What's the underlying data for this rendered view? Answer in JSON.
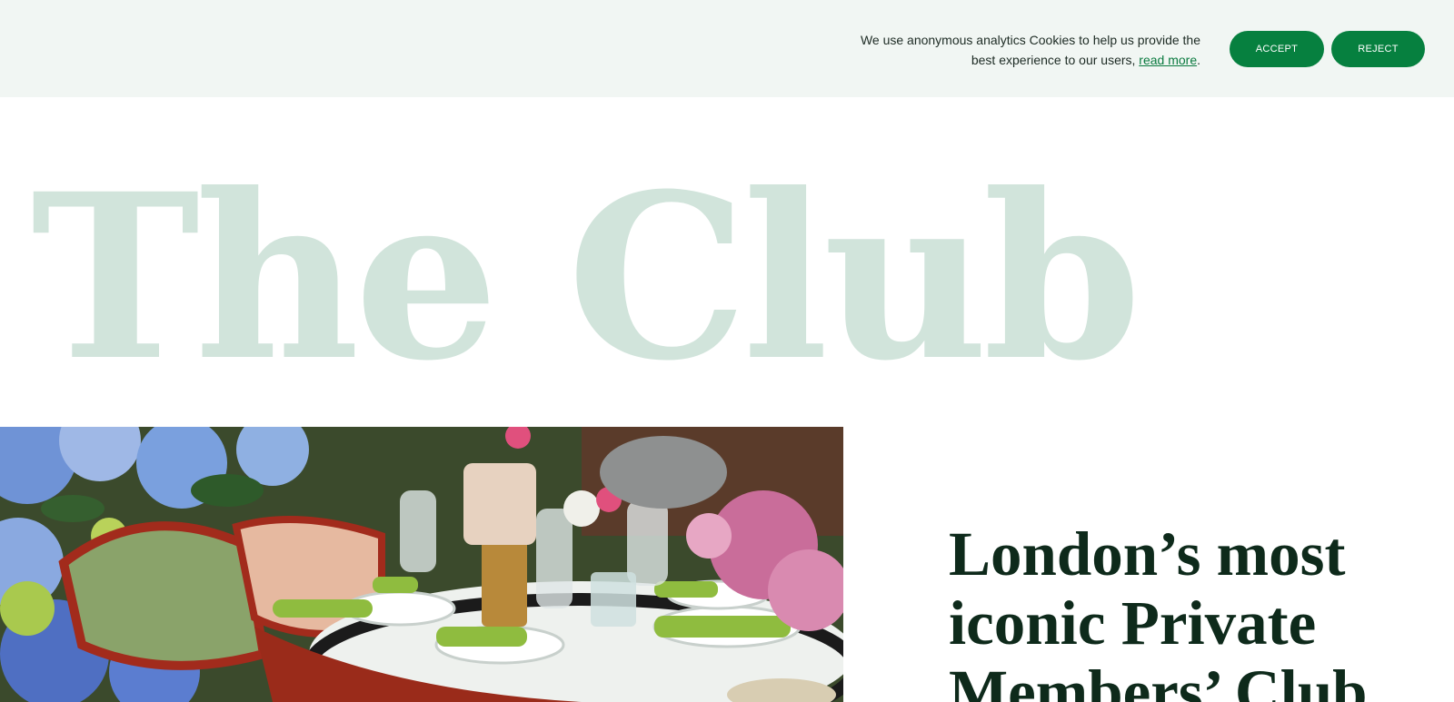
{
  "cookie_banner": {
    "message": "We use anonymous analytics Cookies to help us provide the best experience to our users, ",
    "link_label": "read more",
    "suffix": ".",
    "accept_label": "ACCEPT",
    "reject_label": "REJECT"
  },
  "hero": {
    "title": "The Club"
  },
  "intro": {
    "tagline": "London’s most iconic Private Members’ Club"
  },
  "colors": {
    "banner_bg": "#f1f6f3",
    "button_green": "#06803f",
    "title_mint": "#d1e4db",
    "tagline_dark": "#0e2a1b"
  },
  "photo": {
    "icon": "dining-table-photo"
  }
}
